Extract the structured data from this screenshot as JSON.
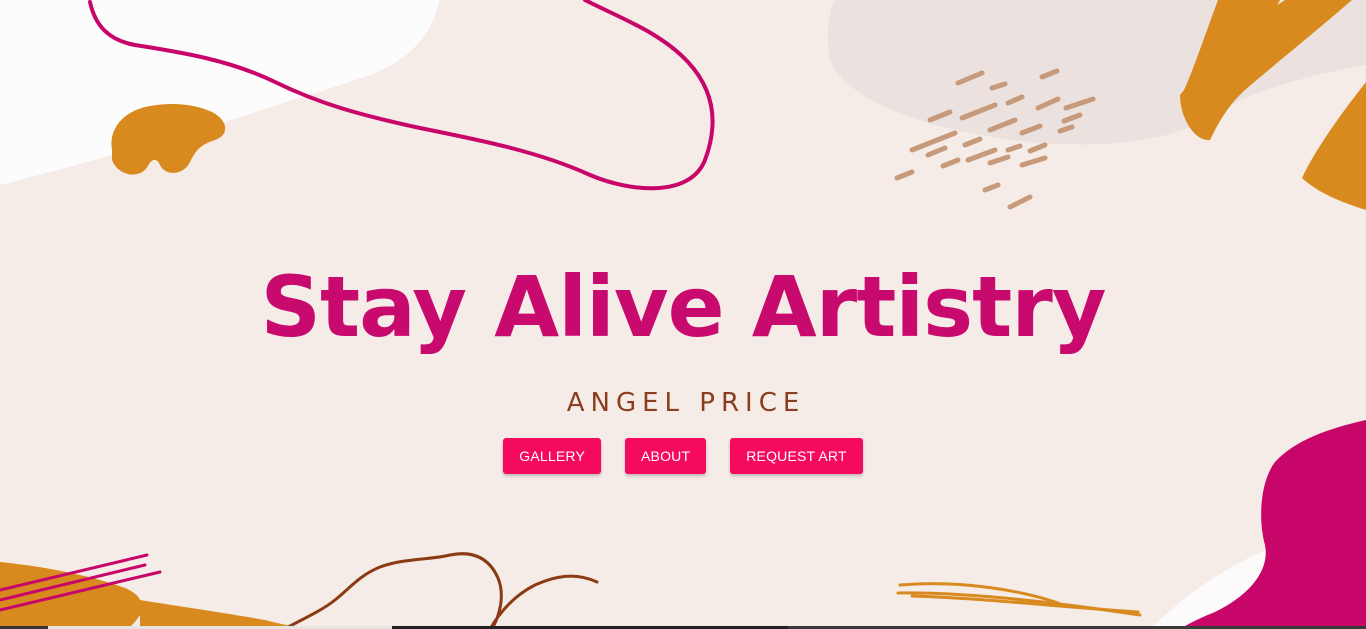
{
  "hero": {
    "title": "Stay Alive Artistry",
    "subtitle": "ANGEL PRICE"
  },
  "nav": {
    "gallery_label": "GALLERY",
    "about_label": "ABOUT",
    "request_label": "REQUEST ART"
  },
  "colors": {
    "background": "#f5ebe7",
    "title": "#c8096e",
    "subtitle": "#8b3e1e",
    "button": "#f50a5d",
    "mustard": "#d98a1e",
    "magenta": "#c8066a",
    "dash_brown": "#c69a7a",
    "squiggle_brown": "#8b3b14"
  }
}
